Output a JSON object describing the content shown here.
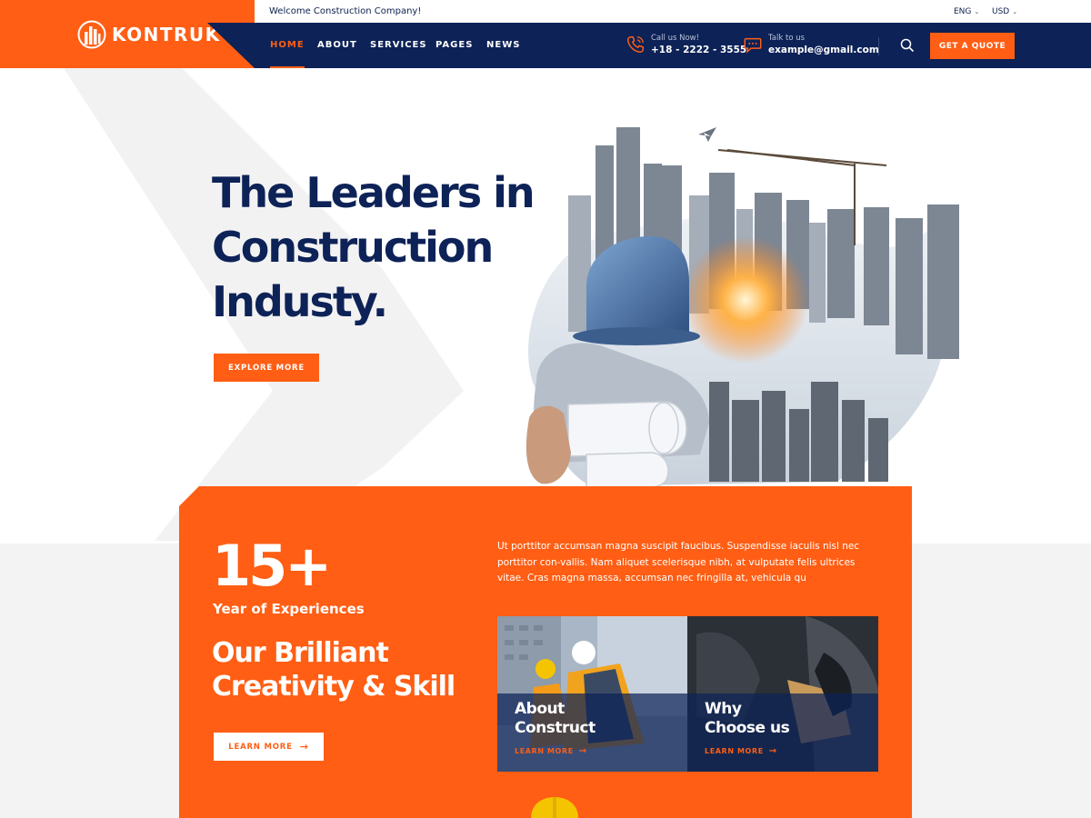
{
  "brand": {
    "name": "KONTRUK"
  },
  "topbar": {
    "welcome": "Welcome Construction Company!",
    "language": "ENG",
    "currency": "USD"
  },
  "nav": {
    "items": [
      {
        "label": "HOME",
        "active": true
      },
      {
        "label": "ABOUT",
        "active": false
      },
      {
        "label": "SERVICES",
        "active": false
      },
      {
        "label": "PAGES",
        "active": false
      },
      {
        "label": "NEWS",
        "active": false
      }
    ],
    "call": {
      "label": "Call us Now!",
      "value": "+18 - 2222 - 3555"
    },
    "talk": {
      "label": "Talk to us",
      "value": "example@gmail.com"
    },
    "quote_label": "GET A QUOTE"
  },
  "hero": {
    "title_lines": [
      "The Leaders in",
      "Construction",
      "Industy."
    ],
    "cta_label": "EXPLORE MORE"
  },
  "stats": {
    "number": "15+",
    "label": "Year of Experiences",
    "title_lines": [
      "Our Brilliant",
      "Creativity & Skill"
    ],
    "cta_label": "LEARN MORE",
    "paragraph": "Ut porttitor accumsan magna suscipit faucibus. Suspendisse iaculis nisl nec porttitor con-vallis. Nam aliquet scelerisque nibh, at vulputate felis ultrices vitae. Cras magna massa, accumsan nec fringilla at, vehicula qu"
  },
  "cards": [
    {
      "title_lines": [
        "About",
        "Construct"
      ],
      "link_label": "LEARN MORE"
    },
    {
      "title_lines": [
        "Why",
        "Choose us"
      ],
      "link_label": "LEARN MORE"
    }
  ],
  "colors": {
    "accent": "#ff5e14",
    "navy": "#0d2257",
    "white": "#ffffff",
    "gray_band": "#f3f3f3"
  },
  "icons": {
    "logo": "building-logo-icon",
    "phone": "phone-icon",
    "chat": "chat-bubble-icon",
    "search": "search-icon",
    "caret": "chevron-down-icon",
    "arrow": "arrow-right-icon"
  }
}
